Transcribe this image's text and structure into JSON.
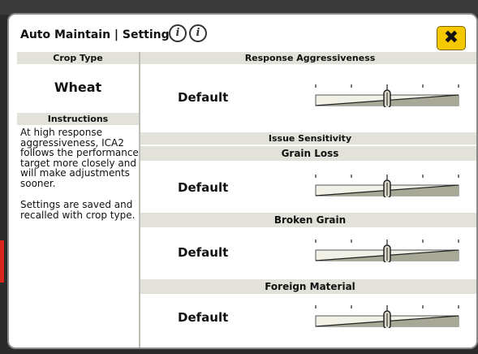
{
  "dialog": {
    "title": "Auto Maintain | Settings",
    "close_label": "✖",
    "info_icons": [
      "i",
      "i"
    ]
  },
  "crop": {
    "header": "Crop Type",
    "value": "Wheat"
  },
  "instructions": {
    "header": "Instructions",
    "paragraphs": [
      "At high response aggressiveness, ICA2 follows the performance target more closely and will make adjustments sooner.",
      "Settings are saved and recalled with crop type."
    ]
  },
  "response": {
    "header": "Response Aggressiveness",
    "value": "Default",
    "level": 0.5
  },
  "issue": {
    "header": "Issue Sensitivity",
    "grain_loss": {
      "label": "Grain Loss",
      "value": "Default",
      "level": 0.5
    },
    "broken_grain": {
      "label": "Broken Grain",
      "value": "Default",
      "level": 0.5
    },
    "foreign_material": {
      "label": "Foreign Material",
      "value": "Default",
      "level": 0.5
    }
  },
  "colors": {
    "header_bg": "#e2e2da",
    "accent": "#f5c800",
    "alert": "#d9261c"
  }
}
